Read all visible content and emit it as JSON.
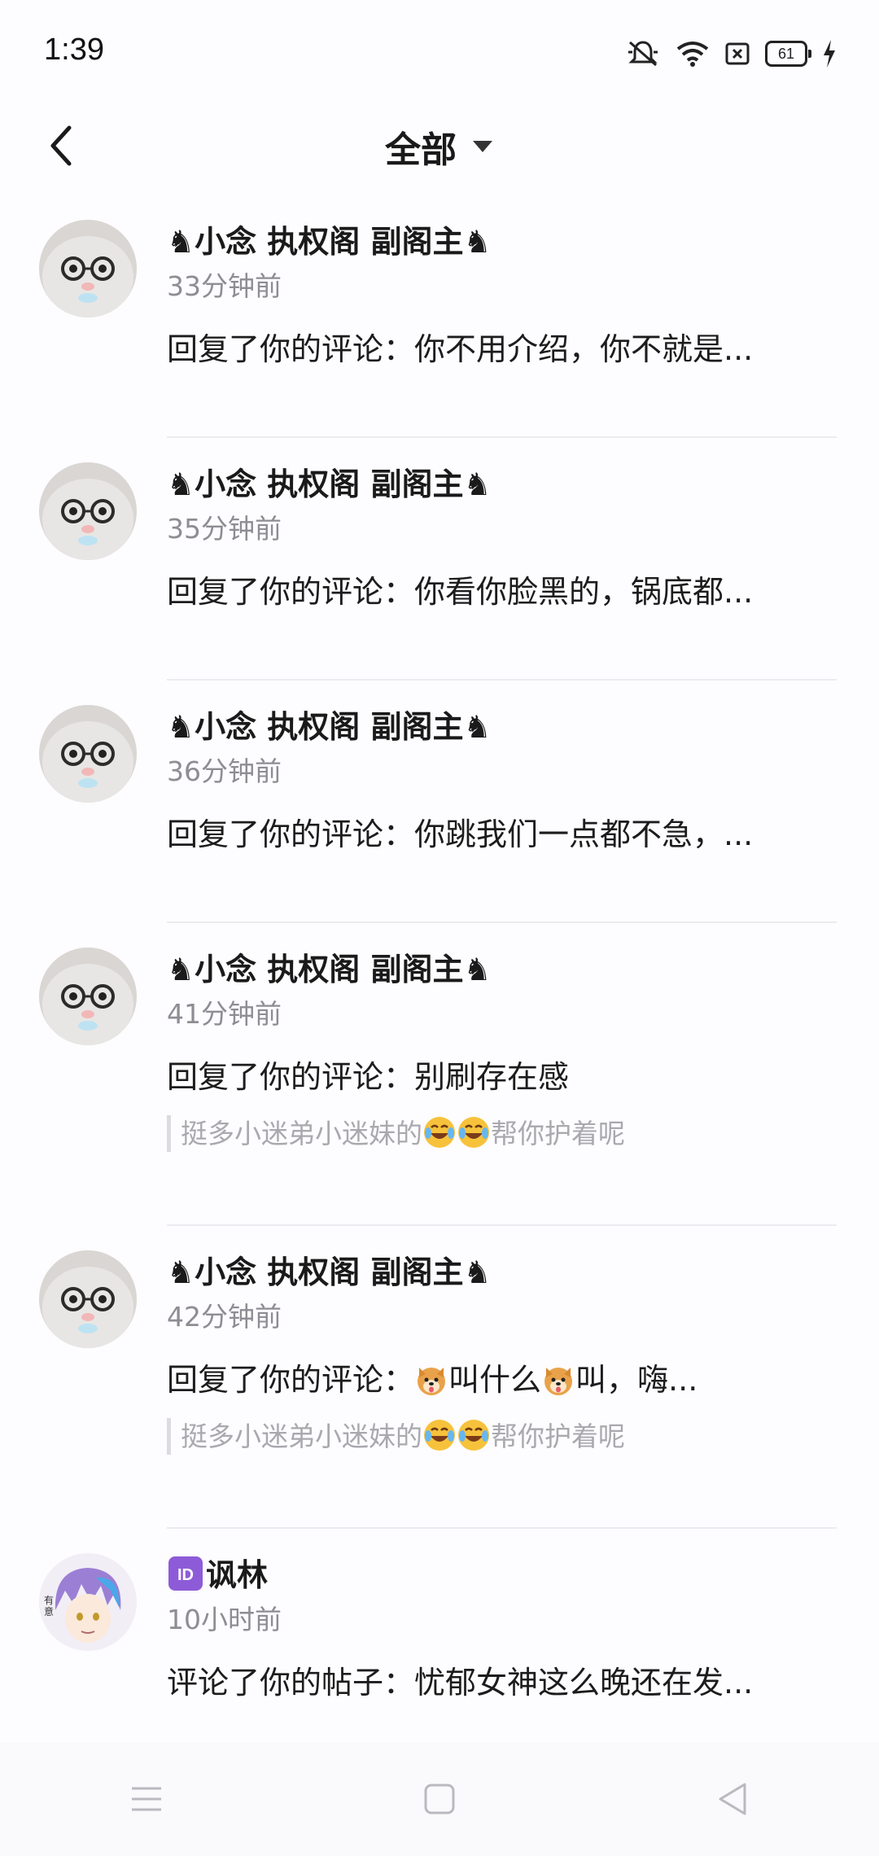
{
  "status_bar": {
    "time": "1:39",
    "battery_level": "61",
    "icons": [
      "bell-muted-icon",
      "wifi-icon",
      "sim-off-icon",
      "battery-icon",
      "charging-icon"
    ]
  },
  "header": {
    "title": "全部",
    "back_icon": "chevron-left-icon",
    "dropdown_icon": "caret-down-icon"
  },
  "notifications": [
    {
      "user": "小念  执权阁  副阁主",
      "time": "33分钟前",
      "prefix": "回复了你的评论：",
      "message": "你不用介绍，你不就是...",
      "quote": ""
    },
    {
      "user": "小念  执权阁  副阁主",
      "time": "35分钟前",
      "prefix": "回复了你的评论：",
      "message": "你看你脸黑的，锅底都...",
      "quote": ""
    },
    {
      "user": "小念  执权阁  副阁主",
      "time": "36分钟前",
      "prefix": "回复了你的评论：",
      "message": "你跳我们一点都不急，...",
      "quote": ""
    },
    {
      "user": "小念  执权阁  副阁主",
      "time": "41分钟前",
      "prefix": "回复了你的评论：",
      "message": "别刷存在感",
      "quote_a": "挺多小迷弟小迷妹的",
      "quote_b": "帮你护着呢"
    },
    {
      "user": "小念  执权阁  副阁主",
      "time": "42分钟前",
      "prefix": "回复了你的评论：",
      "message_a": "叫什么",
      "message_b": "叫，嗨...",
      "quote_a": "挺多小迷弟小迷妹的",
      "quote_b": "帮你护着呢"
    },
    {
      "user": "讽林",
      "time": "10小时前",
      "prefix": "评论了你的帖子：",
      "message": "忧郁女神这么晚还在发..."
    }
  ],
  "nav_bar": {
    "icons": [
      "menu-icon",
      "home-square-icon",
      "back-triangle-icon"
    ]
  }
}
